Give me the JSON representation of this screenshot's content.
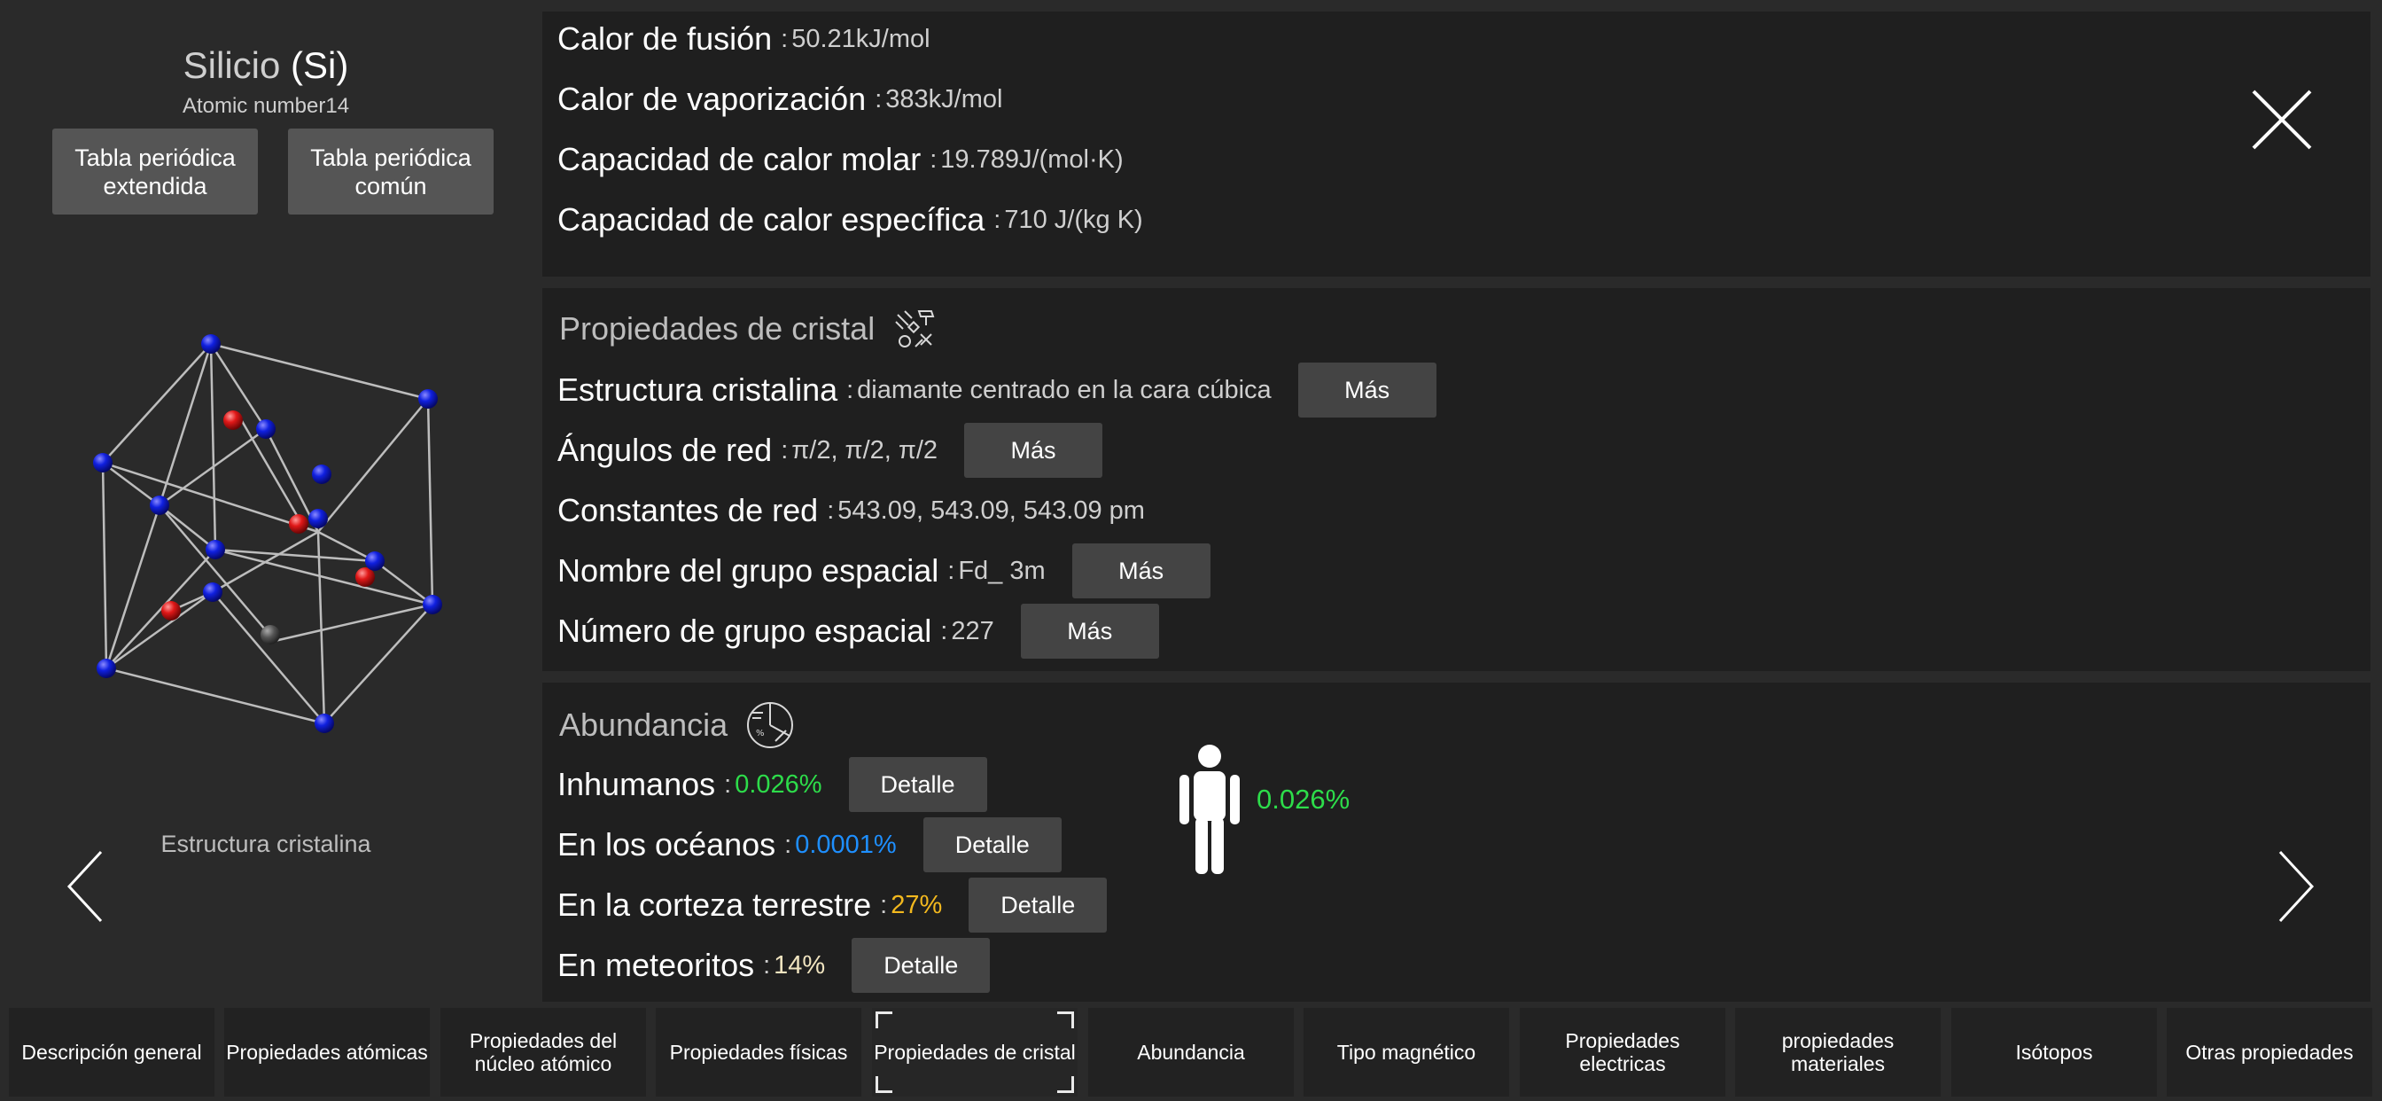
{
  "element": {
    "name": "Silicio",
    "symbol": "(Si)",
    "atomic_number_label": "Atomic number14"
  },
  "left_buttons": {
    "extended": "Tabla periódica extendida",
    "common": "Tabla periódica común"
  },
  "crystal_caption": "Estructura cristalina",
  "thermal": {
    "rows": [
      {
        "label": "Calor de fusión",
        "value": "50.21kJ/mol"
      },
      {
        "label": "Calor de vaporización",
        "value": "383kJ/mol"
      },
      {
        "label": "Capacidad de calor molar",
        "value": "19.789J/(mol·K)"
      },
      {
        "label": "Capacidad de calor específica",
        "value": "710 J/(kg K)"
      }
    ]
  },
  "crystal": {
    "title": "Propiedades de cristal",
    "more_label": "Más",
    "rows": [
      {
        "label": "Estructura cristalina",
        "value": "diamante centrado en la cara cúbica"
      },
      {
        "label": "Ángulos de red",
        "value": "π/2, π/2, π/2"
      },
      {
        "label": "Constantes de red",
        "value": "543.09, 543.09, 543.09 pm"
      },
      {
        "label": "Nombre del grupo espacial",
        "value": "Fd_ 3m"
      },
      {
        "label": "Número de grupo espacial",
        "value": "227"
      }
    ]
  },
  "abundance": {
    "title": "Abundancia",
    "detail_label": "Detalle",
    "rows": [
      {
        "label": "Inhumanos",
        "value": "0.026%",
        "color": "#2ddc4a"
      },
      {
        "label": "En los océanos",
        "value": "0.0001%",
        "color": "#1e8fff"
      },
      {
        "label": "En la corteza terrestre",
        "value": "27%",
        "color": "#f2b81e"
      },
      {
        "label": "En meteoritos",
        "value": "14%",
        "color": "#f0e4c0"
      }
    ],
    "human_value": "0.026%"
  },
  "separator": ":",
  "tabs": [
    "Descripción general",
    "Propiedades atómicas",
    "Propiedades del núcleo atómico",
    "Propiedades físicas",
    "Propiedades de cristal",
    "Abundancia",
    "Tipo magnético",
    "Propiedades electricas",
    "propiedades materiales",
    "Isótopos",
    "Otras propiedades"
  ],
  "active_tab": "Propiedades de cristal",
  "icons": {
    "close": "close-icon",
    "prev": "chevron-left-icon",
    "next": "chevron-right-icon",
    "crystal_section": "crystal-tools-icon",
    "abundance_section": "abundance-pie-icon",
    "human": "human-figure-icon"
  },
  "colors": {
    "panel_bg": "#1f1f1f",
    "page_bg": "#2a2a2a",
    "button_bg": "#444444",
    "atom_blue": "#1020e0",
    "atom_red": "#e01818",
    "atom_gray": "#555555"
  }
}
